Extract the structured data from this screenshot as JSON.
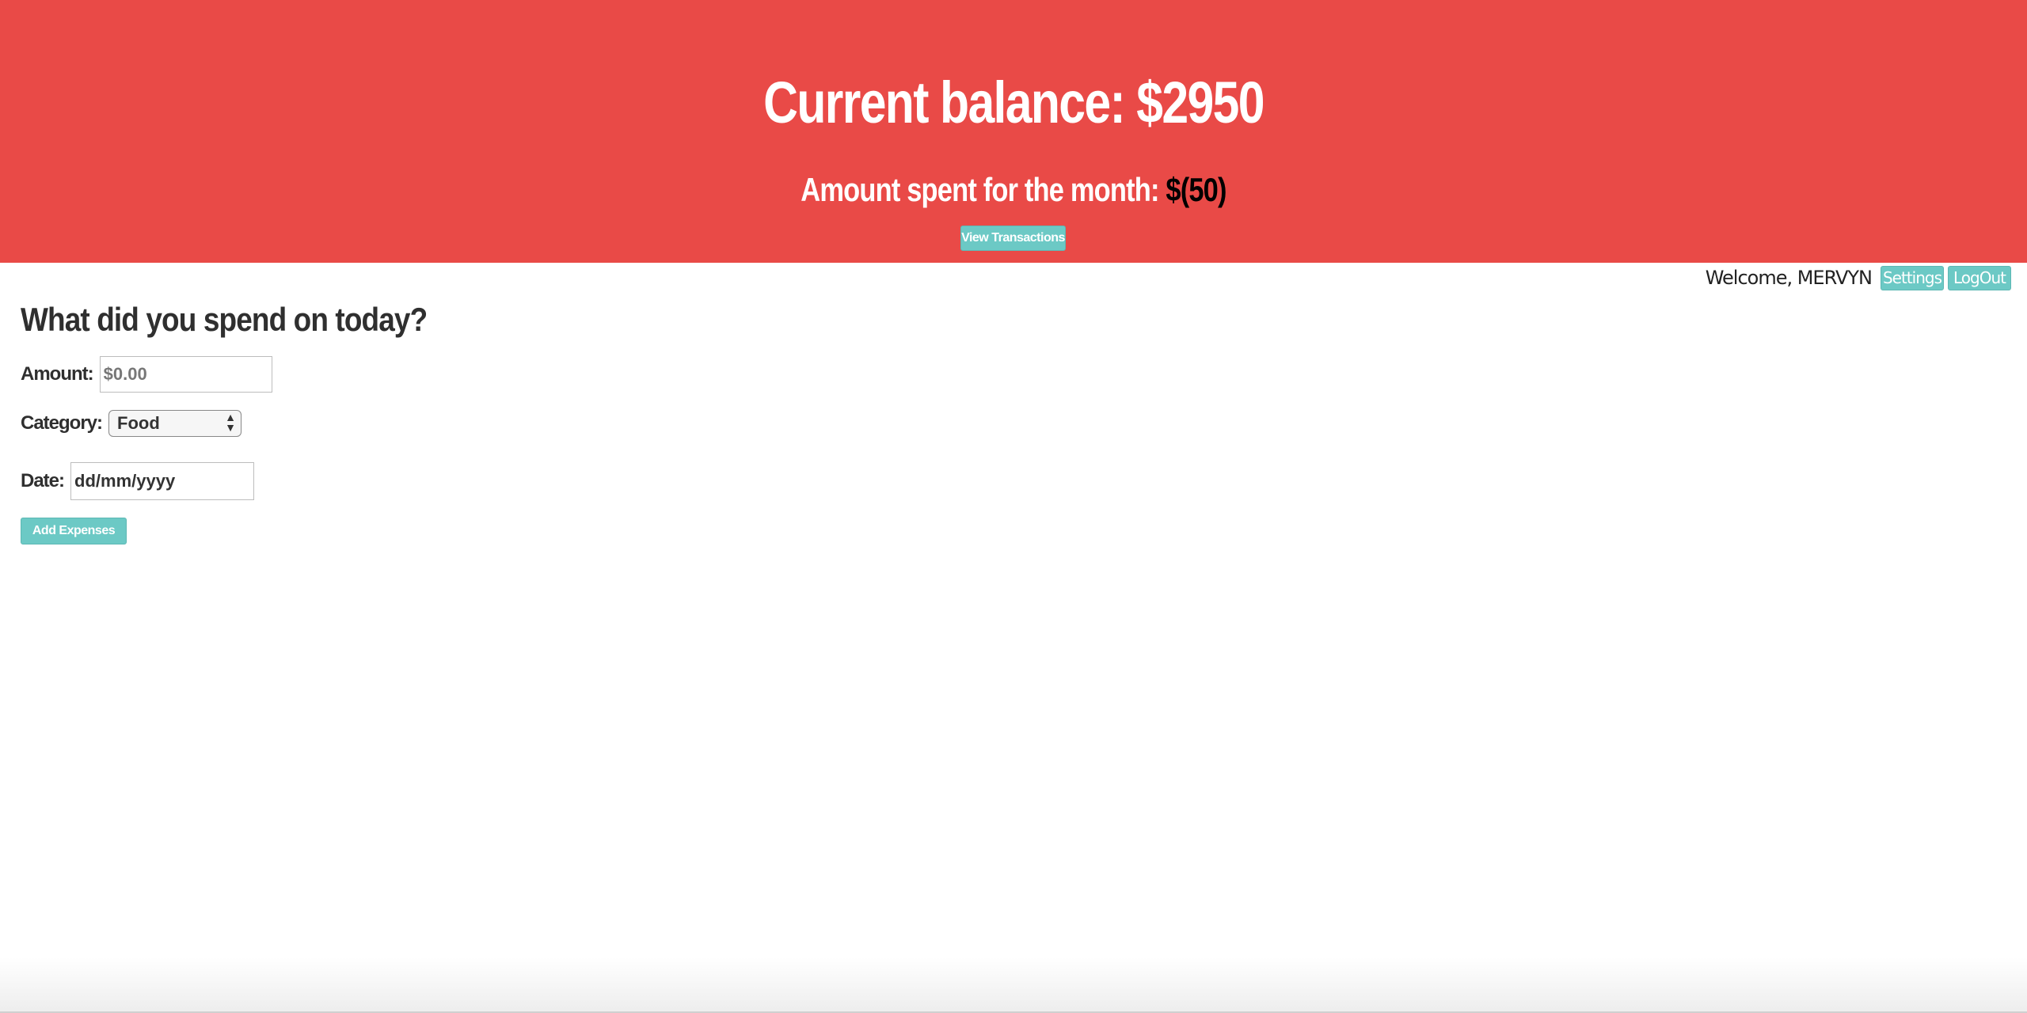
{
  "header": {
    "balance_text": "Current balance: $2950",
    "spent_label": "Amount spent for the month: ",
    "spent_value": "$(50)",
    "view_transactions_label": "View Transactions"
  },
  "userbar": {
    "welcome_text": "Welcome, MERVYN",
    "settings_label": "Settings",
    "logout_label": "LogOut"
  },
  "form": {
    "title": "What did you spend on today?",
    "amount_label": "Amount:",
    "amount_placeholder": "$0.00",
    "category_label": "Category:",
    "category_selected": "Food",
    "date_label": "Date:",
    "date_value": "dd/mm/yyyy",
    "submit_label": "Add Expenses"
  },
  "colors": {
    "header_bg": "#e94a47",
    "button_bg": "#6cc9c5",
    "text_dark": "#2f2f2f"
  }
}
